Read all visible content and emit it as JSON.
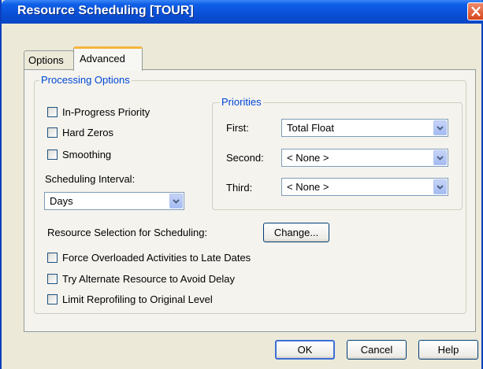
{
  "window": {
    "title": "Resource Scheduling [TOUR]"
  },
  "tabs": {
    "options": "Options",
    "advanced": "Advanced"
  },
  "processing": {
    "legend": "Processing Options",
    "in_progress_priority": "In-Progress Priority",
    "hard_zeros": "Hard Zeros",
    "smoothing": "Smoothing",
    "scheduling_interval_label": "Scheduling Interval:",
    "scheduling_interval_value": "Days"
  },
  "priorities": {
    "legend": "Priorities",
    "first_label": "First:",
    "first_value": "Total Float",
    "second_label": "Second:",
    "second_value": "< None >",
    "third_label": "Third:",
    "third_value": "< None >"
  },
  "resource_selection": {
    "label": "Resource Selection for Scheduling:",
    "button": "Change..."
  },
  "options": {
    "force_overloaded": "Force Overloaded Activities to Late Dates",
    "try_alternate": "Try Alternate Resource to Avoid Delay",
    "limit_reprofiling": "Limit Reprofiling to Original Level"
  },
  "buttons": {
    "ok": "OK",
    "cancel": "Cancel",
    "help": "Help"
  },
  "icons": {
    "close": "close-icon",
    "dropdown": "chevron-down-icon"
  }
}
